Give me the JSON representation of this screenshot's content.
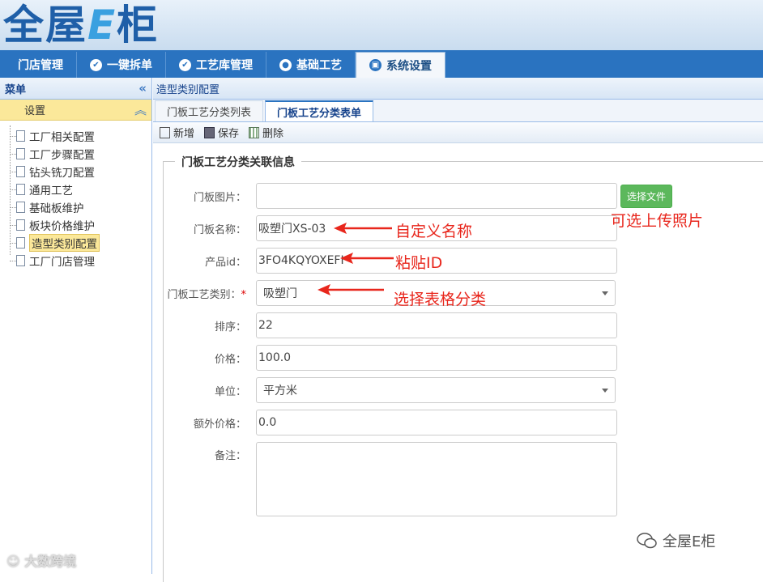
{
  "logo": {
    "part1": "全屋",
    "e": "E",
    "part2": "柜"
  },
  "nav": {
    "tabs": [
      {
        "label": "门店管理"
      },
      {
        "label": "一键拆单"
      },
      {
        "label": "工艺库管理"
      },
      {
        "label": "基础工艺"
      },
      {
        "label": "系统设置"
      }
    ]
  },
  "sidebar": {
    "title": "菜单",
    "section": "设置",
    "items": [
      {
        "label": "工厂相关配置"
      },
      {
        "label": "工厂步骤配置"
      },
      {
        "label": "钻头铣刀配置"
      },
      {
        "label": "通用工艺"
      },
      {
        "label": "基础板维护"
      },
      {
        "label": "板块价格维护"
      },
      {
        "label": "造型类别配置"
      },
      {
        "label": "工厂门店管理"
      }
    ]
  },
  "breadcrumb": "造型类别配置",
  "tabs": [
    {
      "label": "门板工艺分类列表"
    },
    {
      "label": "门板工艺分类表单"
    }
  ],
  "toolbar": {
    "new": "新增",
    "save": "保存",
    "delete": "删除"
  },
  "form": {
    "legend": "门板工艺分类关联信息",
    "fields": {
      "image": {
        "label": "门板图片：",
        "value": "",
        "button": "选择文件"
      },
      "name": {
        "label": "门板名称：",
        "value": "吸塑门XS-03"
      },
      "product_id": {
        "label": "产品id：",
        "value": "3FO4KQYOXEFI"
      },
      "category": {
        "label": "门板工艺类别：",
        "required": "*",
        "value": "吸塑门"
      },
      "sort": {
        "label": "排序：",
        "value": "22"
      },
      "price": {
        "label": "价格：",
        "value": "100.0"
      },
      "unit": {
        "label": "单位：",
        "value": "平方米"
      },
      "extra_price": {
        "label": "额外价格：",
        "value": "0.0"
      },
      "remark": {
        "label": "备注：",
        "value": ""
      }
    }
  },
  "annotations": {
    "upload": "可选上传照片",
    "custom_name": "自定义名称",
    "paste_id": "粘贴ID",
    "select_category": "选择表格分类",
    "color": "#e8261c"
  },
  "watermarks": {
    "left": "大数跨境",
    "right": "全屋E柜"
  }
}
